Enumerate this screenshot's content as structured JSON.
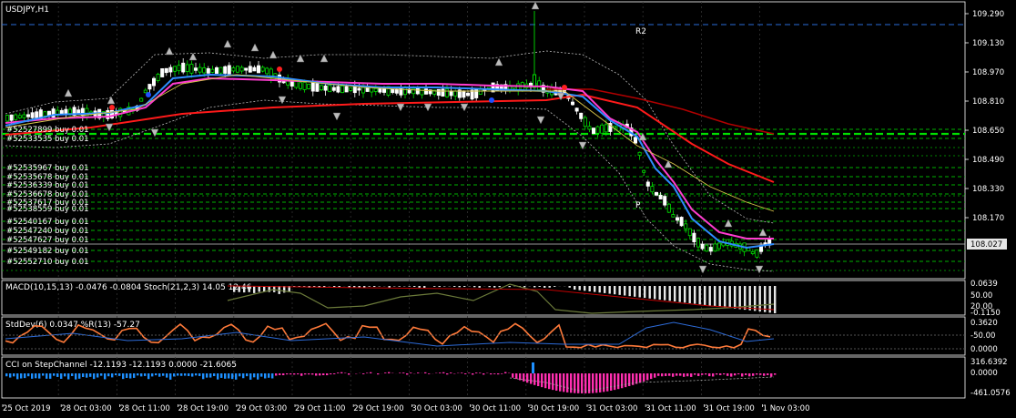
{
  "symbol": "USDJPY,H1",
  "price_badge": "108.027",
  "pivot_labels": {
    "r2": "R2",
    "p": "P"
  },
  "price_axis": [
    "109.290",
    "109.130",
    "108.970",
    "108.810",
    "108.650",
    "108.490",
    "108.330",
    "108.170"
  ],
  "time_axis": [
    "25 Oct 2019",
    "28 Oct 03:00",
    "28 Oct 11:00",
    "28 Oct 19:00",
    "29 Oct 03:00",
    "29 Oct 11:00",
    "29 Oct 19:00",
    "30 Oct 03:00",
    "30 Oct 11:00",
    "30 Oct 19:00",
    "31 Oct 03:00",
    "31 Oct 11:00",
    "31 Oct 19:00",
    "1 Nov 03:00"
  ],
  "orders": [
    "#52527899 buy 0.01",
    "#52533535 buy 0.01",
    "#52535967 buy 0.01",
    "#52535678 buy 0.01",
    "#52536339 buy 0.01",
    "#52536678 buy 0.01",
    "#52537617 buy 0.01",
    "#52538559 buy 0.01",
    "#52540167 buy 0.01",
    "#52547240 buy 0.01",
    "#52547627 buy 0.01",
    "#52549182 buy 0.01",
    "#52552710 buy 0.01"
  ],
  "panels": {
    "macd": {
      "title": "MACD(10,15,13) -0.0476 -0.0804 Stoch(21,2,3) 14.05 12.46",
      "axis": [
        "0.0639",
        "50.00",
        "20.00",
        "-0.1150"
      ]
    },
    "stddev": {
      "title": "StdDev(6) 0.0347 %R(13) -57.27",
      "axis": [
        "0.3620",
        "-50.00",
        "0.0000"
      ]
    },
    "cci": {
      "title": "CCI on StepChannel -12.1193 -12.1193 0.0000 -21.6065",
      "axis": [
        "316.6392",
        "0.0000",
        "-461.0576"
      ]
    }
  },
  "colors": {
    "background": "#000000",
    "bull_candle": "#00e000",
    "bear_candle": "#ffffff",
    "ma_red": "#ff1a1a",
    "ma_darkred": "#b00000",
    "ma_magenta": "#ff3cd0",
    "ma_blue": "#2e8cff",
    "ma_yellow": "#d9c64a",
    "pivot_line": "#00e000",
    "r2_line": "#2a6bd9",
    "stddev_line": "#ff7a3a",
    "wpr_line": "#2d6bd8",
    "cci_pos": "#1e90ff",
    "cci_neg": "#ff2fb0"
  },
  "chart_data": {
    "type": "candlestick",
    "symbol": "USDJPY",
    "timeframe": "H1",
    "x": [
      "25 Oct 2019",
      "28 Oct 03:00",
      "28 Oct 11:00",
      "28 Oct 19:00",
      "29 Oct 03:00",
      "29 Oct 11:00",
      "29 Oct 19:00",
      "30 Oct 03:00",
      "30 Oct 11:00",
      "30 Oct 19:00",
      "31 Oct 03:00",
      "31 Oct 11:00",
      "31 Oct 19:00",
      "1 Nov 03:00"
    ],
    "close_approx": [
      108.66,
      108.7,
      108.98,
      108.97,
      108.95,
      108.88,
      108.85,
      108.86,
      108.86,
      108.84,
      108.74,
      108.4,
      108.05,
      108.03
    ],
    "ylim": [
      107.98,
      109.3
    ],
    "last_price": 108.027,
    "horizontal_levels": {
      "R2": 109.21,
      "P": 108.3
    }
  }
}
